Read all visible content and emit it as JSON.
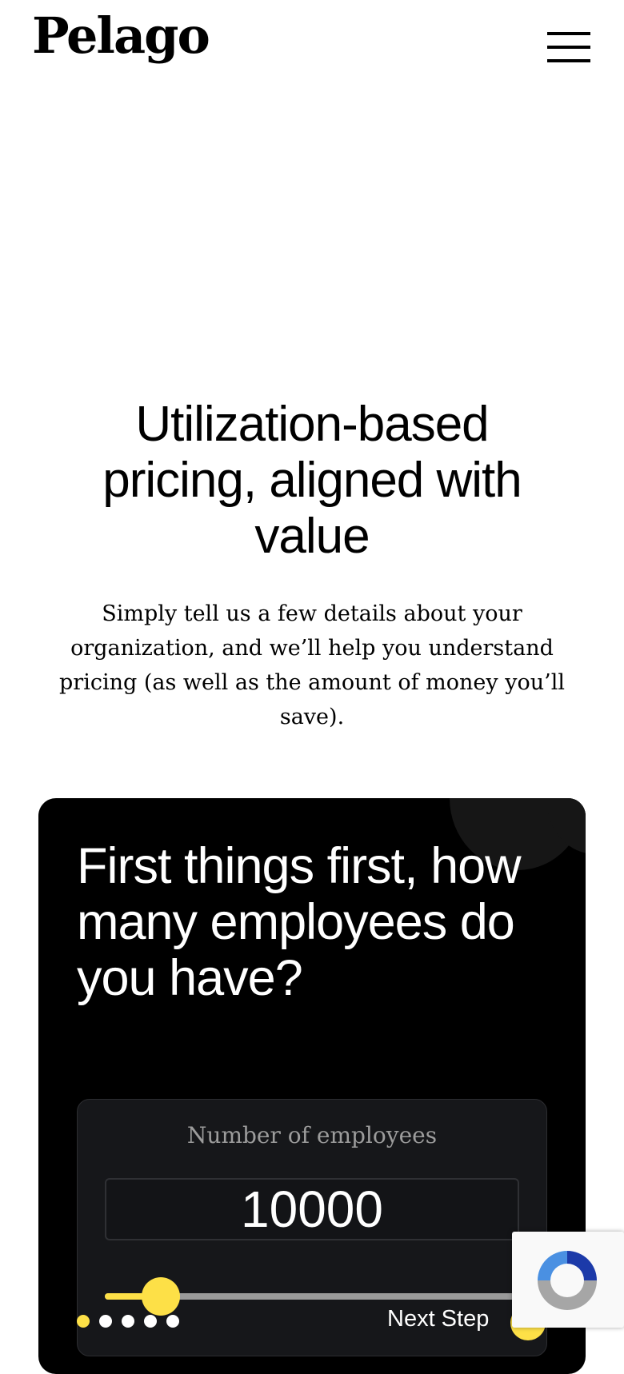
{
  "header": {
    "logo_text": "Pelago",
    "menu_icon": "hamburger-menu-icon"
  },
  "hero": {
    "title": "Utilization-based pricing, aligned with value",
    "subtitle": "Simply tell us a few details about your organization, and we’ll help you understand pricing (as well as the amount of money you’ll save)."
  },
  "calculator": {
    "question": "First things first, how many employees do you have?",
    "input_label": "Number of employees",
    "employees_value": "10000",
    "slider_level": 0.135,
    "steps_total": 5,
    "current_step": 1,
    "next_label": "Next Step",
    "accent_color": "#fde047"
  },
  "recaptcha": {
    "icon": "recaptcha-icon"
  }
}
